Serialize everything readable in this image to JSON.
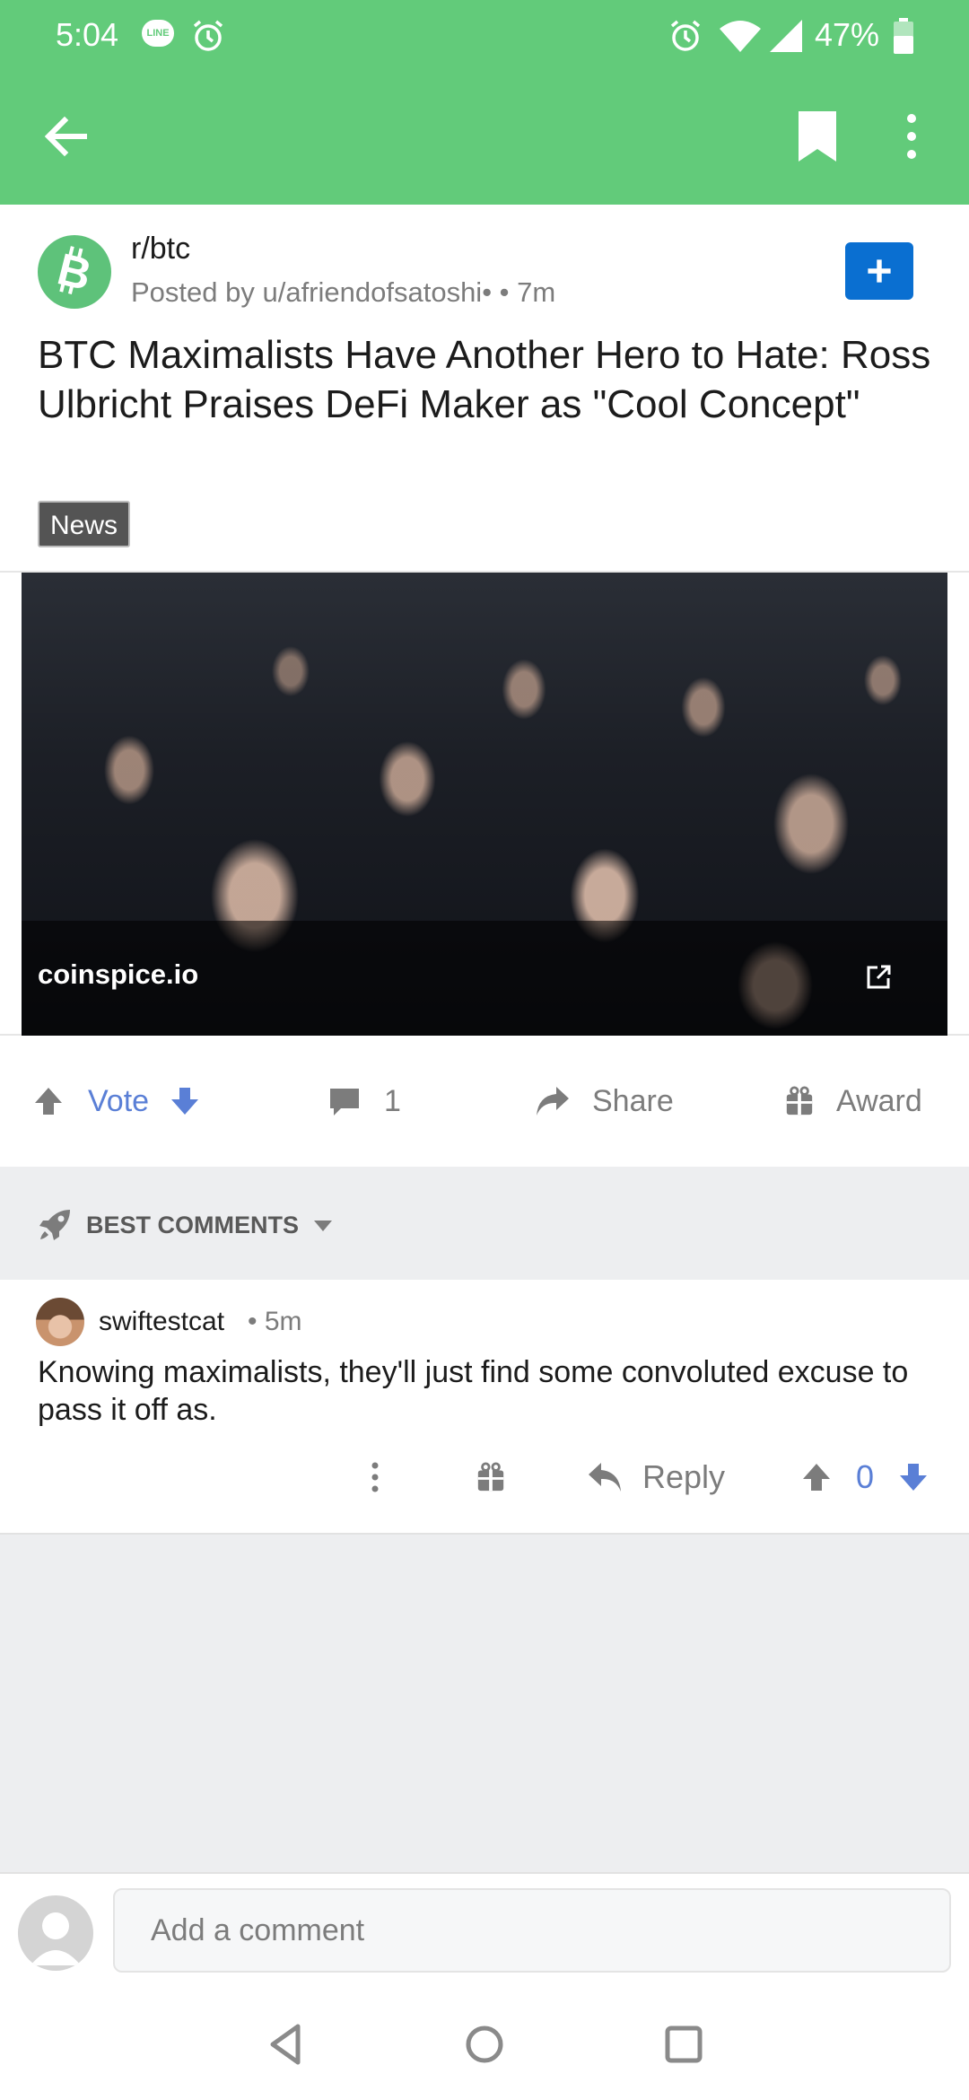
{
  "status_bar": {
    "time": "5:04",
    "line_badge": "LINE",
    "battery_percent": "47%"
  },
  "toolbar": {
    "back_icon": "arrow-left-icon",
    "bookmark_icon": "bookmark-icon",
    "more_icon": "more-vertical-icon",
    "color": "#62cb7a"
  },
  "post": {
    "subreddit": "r/btc",
    "posted_by": "Posted by u/afriendofsatoshi•  • 7m",
    "title": "BTC Maximalists Have Another Hero to Hate: Ross Ulbricht Praises DeFi Maker as \"Cool Concept\"",
    "flair": "News",
    "link_domain": "coinspice.io",
    "join_icon": "plus-icon",
    "join_color": "#0a6fd1"
  },
  "actions": {
    "vote_label": "Vote",
    "comment_count": "1",
    "share_label": "Share",
    "award_label": "Award",
    "vote_color": "#5a7fd6"
  },
  "comments_header": {
    "label": "BEST COMMENTS"
  },
  "comments": [
    {
      "user": "swiftestcat",
      "time": "• 5m",
      "body": "Knowing maximalists, they'll just find some convoluted excuse to pass it off as.",
      "reply_label": "Reply",
      "score": "0"
    }
  ],
  "compose": {
    "placeholder": "Add a comment"
  }
}
